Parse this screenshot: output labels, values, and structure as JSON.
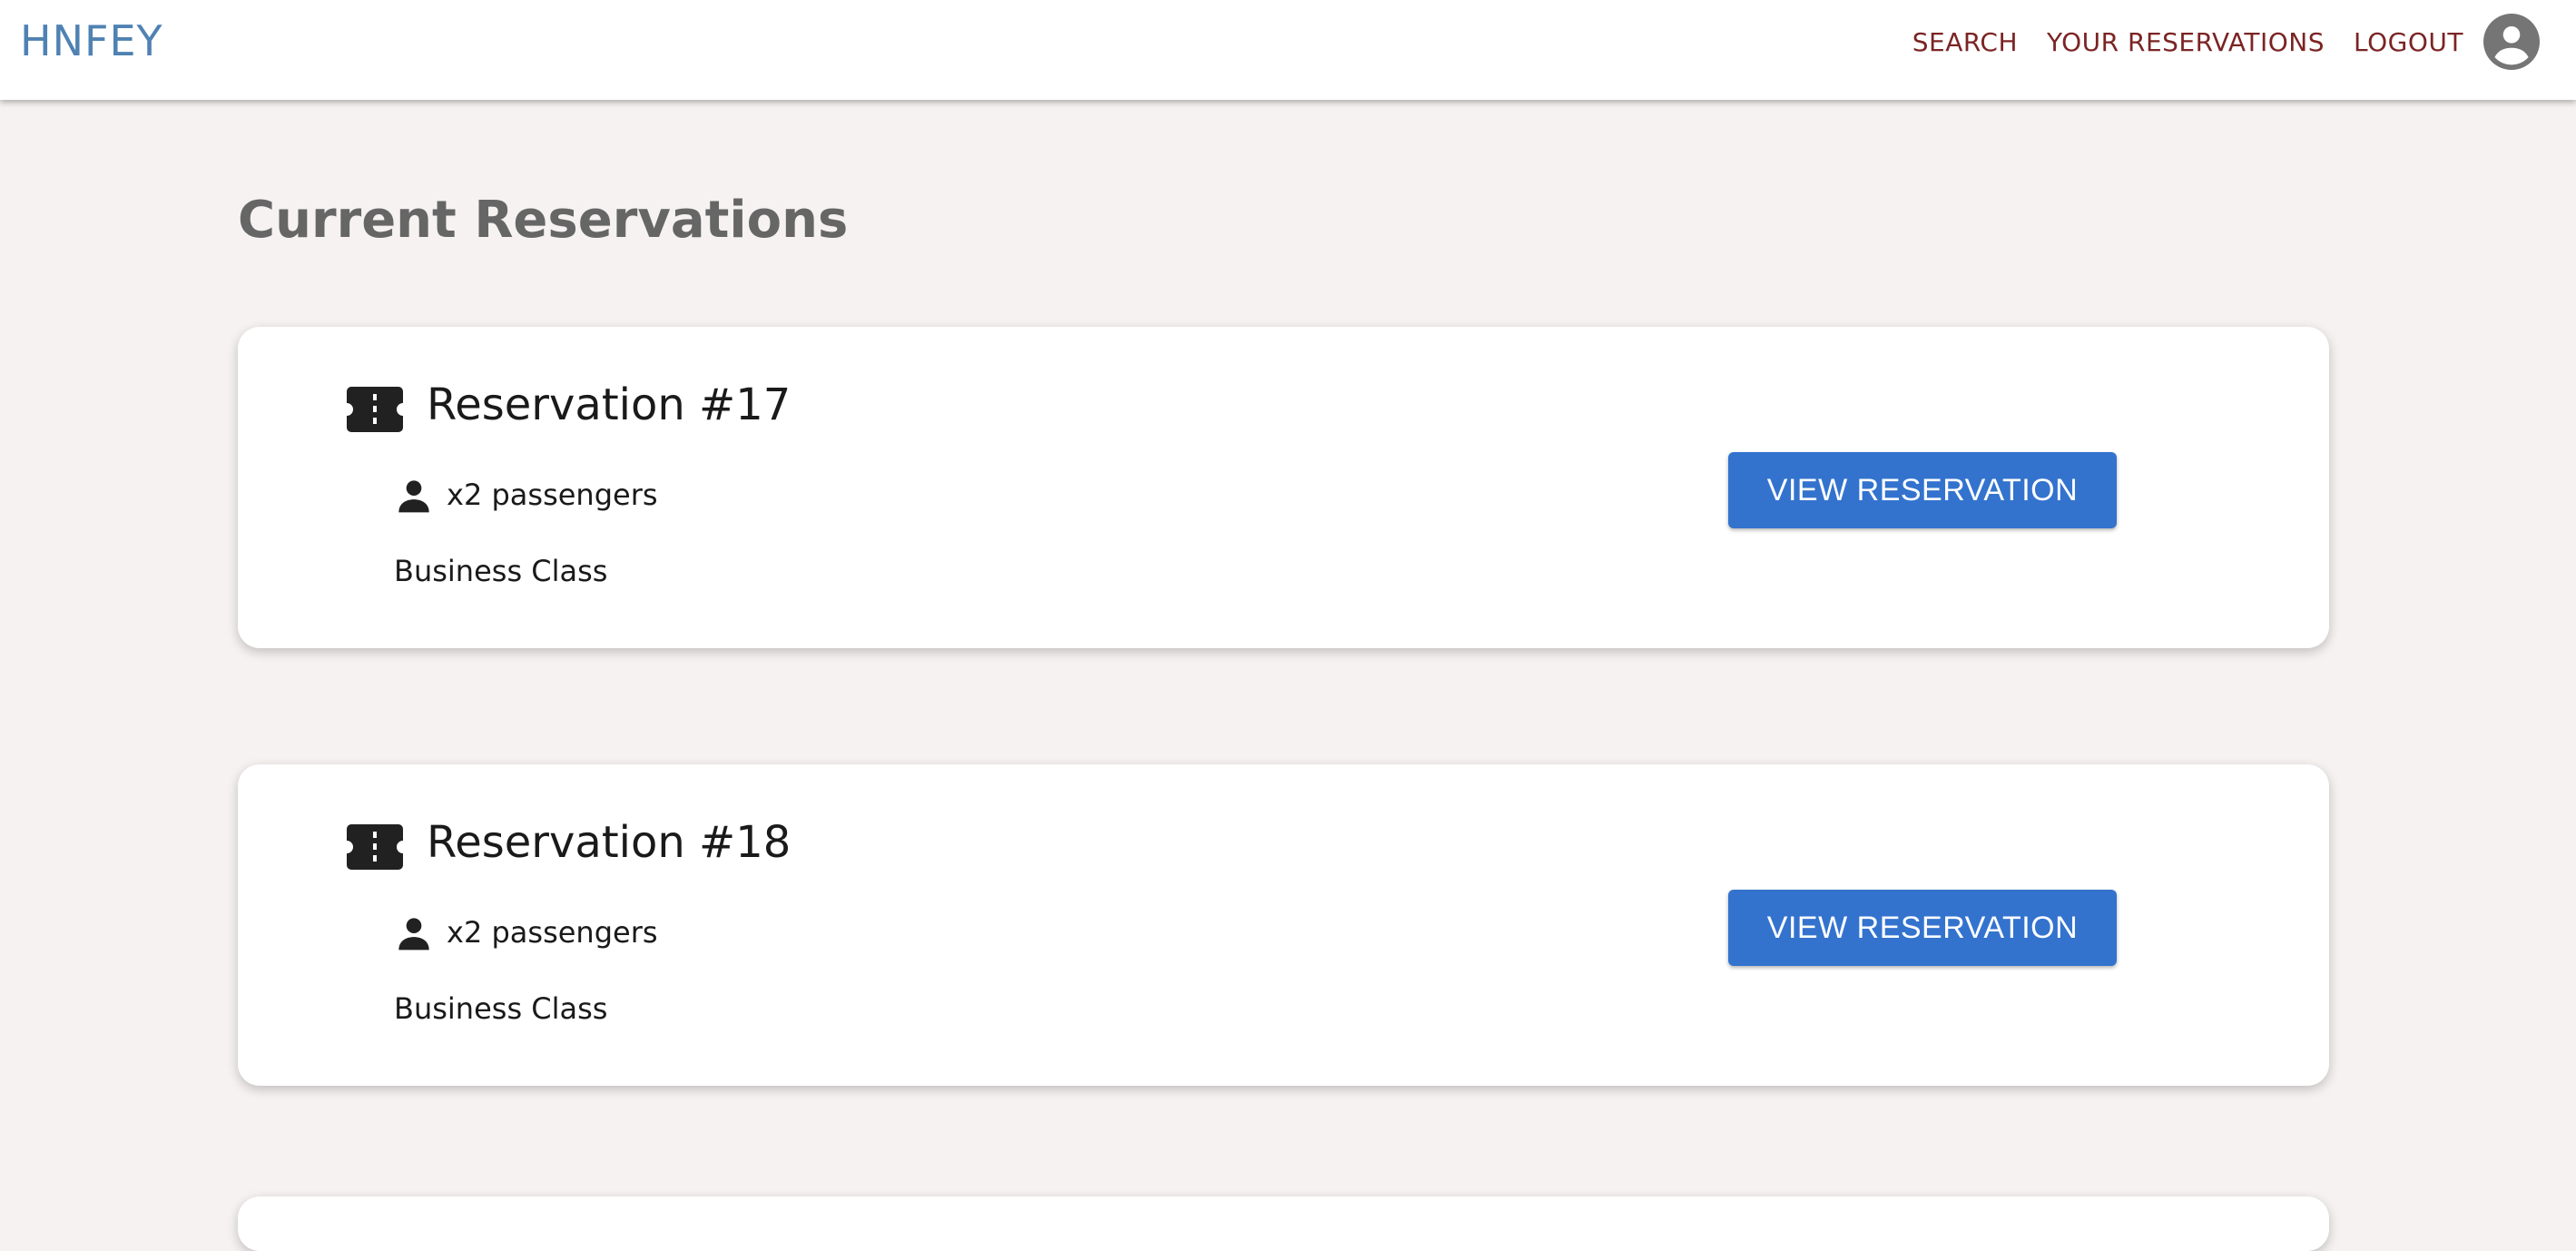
{
  "header": {
    "brand": "HNFEY",
    "nav": {
      "search": "SEARCH",
      "your_reservations": "YOUR RESERVATIONS",
      "logout": "LOGOUT"
    },
    "avatar_icon": "account-circle-icon"
  },
  "page_title": "Current Reservations",
  "reservations": [
    {
      "title": "Reservation #17",
      "passengers": "x2 passengers",
      "class": "Business Class",
      "button_label": "VIEW RESERVATION"
    },
    {
      "title": "Reservation #18",
      "passengers": "x2 passengers",
      "class": "Business Class",
      "button_label": "VIEW RESERVATION"
    }
  ],
  "icons": {
    "ticket": "ticket-icon",
    "person": "person-icon"
  },
  "colors": {
    "brand": "#4f82b2",
    "nav_link": "#7b2424",
    "button": "#3373ce",
    "background": "#f6f2f1"
  }
}
